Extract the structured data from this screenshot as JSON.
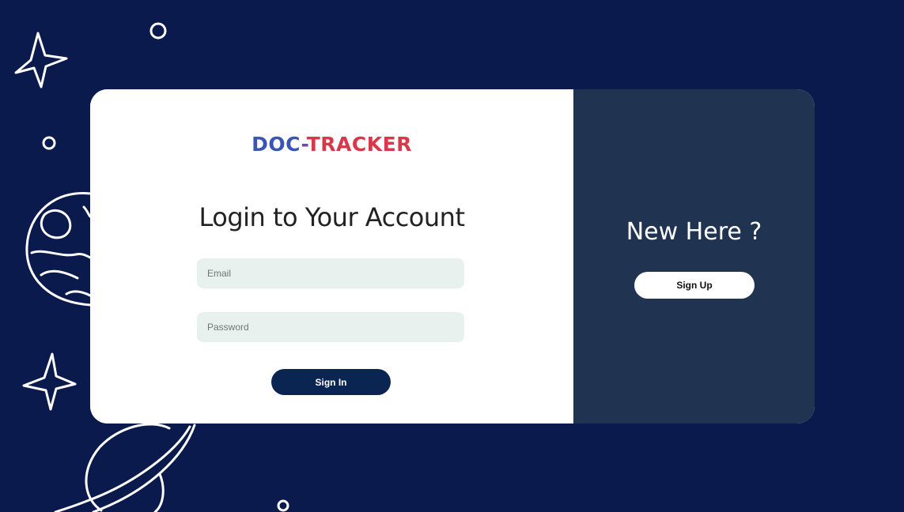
{
  "logo": {
    "part_a": "DOC",
    "dash": "-",
    "part_b": "TRACKER"
  },
  "login": {
    "title": "Login to Your Account",
    "email_placeholder": "Email",
    "password_placeholder": "Password",
    "signin_label": "Sign In"
  },
  "signup_panel": {
    "heading": "New Here ?",
    "signup_label": "Sign Up"
  },
  "colors": {
    "background": "#0b1a4d",
    "right_panel": "#203452",
    "signin_button": "#0b2553",
    "logo_blue": "#3a56b4",
    "logo_red": "#d8384a",
    "input_fill": "#e9f1ee"
  },
  "decorations": [
    "star-icon",
    "planet-icon",
    "ringed-planet-icon",
    "circle-icon"
  ]
}
